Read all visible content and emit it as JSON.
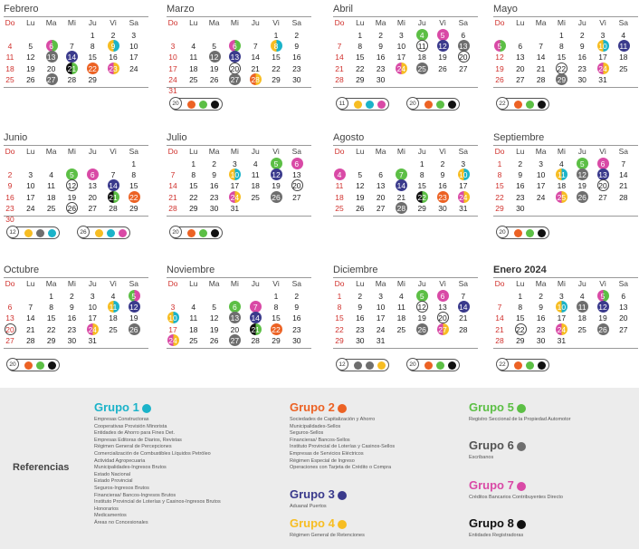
{
  "colors": {
    "g1": "#1bb3c9",
    "g2": "#ec6224",
    "g3": "#3a3a8c",
    "g4": "#f7bd22",
    "g5": "#5cbf45",
    "g6": "#6e6e6e",
    "g7": "#d94aa6",
    "g8": "#111111"
  },
  "weekdays": [
    "Do",
    "Lu",
    "Ma",
    "Mi",
    "Ju",
    "Vi",
    "Sa"
  ],
  "months": [
    {
      "name": "Febrero",
      "start": 4,
      "days": 29,
      "bold": false,
      "marks": {
        "6": [
          "g7",
          "g5"
        ],
        "9": [
          "g4",
          "g1"
        ],
        "13": [
          "g6"
        ],
        "14": [
          "g3"
        ],
        "21": [
          "g8",
          "g5"
        ],
        "22": [
          "g2"
        ],
        "23": [
          "g7",
          "g4"
        ],
        "27": [
          "g6"
        ]
      },
      "chips": []
    },
    {
      "name": "Marzo",
      "start": 5,
      "days": 31,
      "bold": false,
      "marks": {
        "6": [
          "g7",
          "g5"
        ],
        "8": [
          "g4",
          "g1"
        ],
        "12": [
          "g6"
        ],
        "13": [
          "g3"
        ],
        "20": [
          "ring"
        ],
        "27": [
          "g6"
        ],
        "28": [
          "g2",
          "g4"
        ]
      },
      "chips": [
        {
          "day": "20",
          "dots": [
            "g2",
            "g5",
            "g8"
          ]
        }
      ]
    },
    {
      "name": "Abril",
      "start": 1,
      "days": 30,
      "bold": false,
      "marks": {
        "4": [
          "g5"
        ],
        "5": [
          "g7"
        ],
        "11": [
          "ring"
        ],
        "12": [
          "g3"
        ],
        "13": [
          "g6"
        ],
        "20": [
          "ring"
        ],
        "24": [
          "g7",
          "g4"
        ],
        "25": [
          "g6"
        ]
      },
      "chips": [
        {
          "day": "11",
          "dots": [
            "g4",
            "g1",
            "g7"
          ]
        },
        {
          "day": "20",
          "dots": [
            "g2",
            "g5",
            "g8"
          ]
        }
      ]
    },
    {
      "name": "Mayo",
      "start": 3,
      "days": 31,
      "bold": false,
      "marks": {
        "5": [
          "g7",
          "g5"
        ],
        "10": [
          "g4",
          "g1"
        ],
        "11": [
          "g3"
        ],
        "22": [
          "ring"
        ],
        "24": [
          "g7",
          "g4"
        ],
        "29": [
          "g6"
        ]
      },
      "chips": [
        {
          "day": "22",
          "dots": [
            "g2",
            "g5",
            "g8"
          ]
        }
      ]
    },
    {
      "name": "Junio",
      "start": 6,
      "days": 30,
      "bold": false,
      "marks": {
        "5": [
          "g5"
        ],
        "6": [
          "g7"
        ],
        "12": [
          "ring"
        ],
        "14": [
          "g3"
        ],
        "21": [
          "g8",
          "g5"
        ],
        "22": [
          "g2"
        ],
        "26": [
          "ring"
        ]
      },
      "chips": [
        {
          "day": "12",
          "dots": [
            "g4",
            "g6",
            "g1"
          ]
        },
        {
          "day": "26",
          "dots": [
            "g4",
            "g1",
            "g7"
          ]
        }
      ]
    },
    {
      "name": "Julio",
      "start": 1,
      "days": 31,
      "bold": false,
      "marks": {
        "5": [
          "g5"
        ],
        "6": [
          "g7"
        ],
        "10": [
          "g4",
          "g1"
        ],
        "12": [
          "g3"
        ],
        "20": [
          "ring"
        ],
        "24": [
          "g7",
          "g4"
        ],
        "26": [
          "g6"
        ]
      },
      "chips": [
        {
          "day": "20",
          "dots": [
            "g2",
            "g5",
            "g8"
          ]
        }
      ]
    },
    {
      "name": "Agosto",
      "start": 4,
      "days": 31,
      "bold": false,
      "marks": {
        "4": [
          "g7"
        ],
        "7": [
          "g5"
        ],
        "10": [
          "g4",
          "g1"
        ],
        "14": [
          "g3"
        ],
        "22": [
          "g8",
          "g5"
        ],
        "23": [
          "g2"
        ],
        "24": [
          "g7",
          "g4"
        ],
        "28": [
          "g6"
        ]
      },
      "chips": []
    },
    {
      "name": "Septiembre",
      "start": 0,
      "days": 30,
      "bold": false,
      "marks": {
        "5": [
          "g5"
        ],
        "6": [
          "g7"
        ],
        "11": [
          "g4",
          "g1"
        ],
        "12": [
          "g6"
        ],
        "13": [
          "g3"
        ],
        "20": [
          "ring"
        ],
        "25": [
          "g7",
          "g4"
        ],
        "26": [
          "g6"
        ]
      },
      "chips": [
        {
          "day": "20",
          "dots": [
            "g2",
            "g5",
            "g8"
          ]
        }
      ]
    },
    {
      "name": "Octubre",
      "start": 2,
      "days": 31,
      "bold": false,
      "marks": {
        "5": [
          "g5",
          "g7"
        ],
        "11": [
          "g4",
          "g1"
        ],
        "12": [
          "g3"
        ],
        "20": [
          "ring"
        ],
        "24": [
          "g7",
          "g4"
        ],
        "26": [
          "g6"
        ]
      },
      "chips": [
        {
          "day": "20",
          "dots": [
            "g2",
            "g5",
            "g8"
          ]
        }
      ]
    },
    {
      "name": "Noviembre",
      "start": 5,
      "days": 30,
      "bold": false,
      "marks": {
        "6": [
          "g5"
        ],
        "7": [
          "g7"
        ],
        "10": [
          "g4",
          "g1"
        ],
        "13": [
          "g6"
        ],
        "14": [
          "g3"
        ],
        "21": [
          "g8",
          "g5"
        ],
        "22": [
          "g2"
        ],
        "24": [
          "g7",
          "g4"
        ],
        "27": [
          "g6"
        ]
      },
      "chips": []
    },
    {
      "name": "Diciembre",
      "start": 0,
      "days": 31,
      "bold": false,
      "marks": {
        "5": [
          "g5"
        ],
        "6": [
          "g7"
        ],
        "12": [
          "ring"
        ],
        "14": [
          "g3"
        ],
        "20": [
          "ring"
        ],
        "26": [
          "g6"
        ],
        "27": [
          "g7",
          "g4"
        ]
      },
      "chips": [
        {
          "day": "12",
          "dots": [
            "g6",
            "g6",
            "g4"
          ]
        },
        {
          "day": "20",
          "dots": [
            "g2",
            "g5",
            "g8"
          ]
        }
      ]
    },
    {
      "name": "Enero 2024",
      "start": 1,
      "days": 31,
      "bold": true,
      "marks": {
        "5": [
          "g7",
          "g5"
        ],
        "10": [
          "g4",
          "g1"
        ],
        "11": [
          "g6"
        ],
        "12": [
          "g3"
        ],
        "22": [
          "ring"
        ],
        "24": [
          "g7",
          "g4"
        ],
        "26": [
          "g6"
        ]
      },
      "chips": [
        {
          "day": "22",
          "dots": [
            "g2",
            "g5",
            "g8"
          ]
        }
      ]
    }
  ],
  "referencias_label": "Referencias",
  "groups": [
    {
      "title": "Grupo 1",
      "color": "g1",
      "items": [
        "Empresas Constructoras",
        "Cooperativas Provisión Minorista",
        "Entidades de Ahorro para Fines Det.",
        "Empresas Editoras de Diarios, Revistas",
        "Régimen General de Percepciones",
        "Comercialización de Combustibles Líquidos Petróleo",
        "Actividad Agropecuaria",
        "Municipalidades-Ingresos Brutos",
        "Estado Nacional",
        "Estado Provincial",
        "Seguros-Ingresos Brutos",
        "Financieras/ Bancos-Ingresos Brutos",
        "Instituto Provincial de Loterías y Casinos-Ingresos Brutos",
        "Honorarios",
        "Medicamentos",
        "Áreas no Concesionales"
      ]
    },
    {
      "title": "Grupo 2",
      "color": "g2",
      "items": [
        "Sociedades de Capitalización y Ahorro",
        "Municipalidades-Sellos",
        "Seguros-Sellos",
        "Financieras/ Bancos-Sellos",
        "Instituto Provincial de Loterías y Casinos-Sellos",
        "Empresas de Servicios Eléctricos",
        "Régimen Especial de Ingreso",
        "Operaciones con Tarjeta de Crédito o Compra"
      ]
    },
    {
      "title": "Grupo 3",
      "color": "g3",
      "items": [
        "Aduanal Puertos"
      ]
    },
    {
      "title": "Grupo 4",
      "color": "g4",
      "items": [
        "Régimen General de Retenciones"
      ]
    },
    {
      "title": "Grupo 5",
      "color": "g5",
      "items": [
        "Registro Seccional de la Propiedad Automotor"
      ]
    },
    {
      "title": "Grupo 6",
      "color": "g6",
      "items": [
        "Escribanos"
      ]
    },
    {
      "title": "Grupo 7",
      "color": "g7",
      "items": [
        "Créditos Bancarios Contribuyentes Directo"
      ]
    },
    {
      "title": "Grupo 8",
      "color": "g8",
      "items": [
        "Entidades Registradoras"
      ]
    }
  ]
}
